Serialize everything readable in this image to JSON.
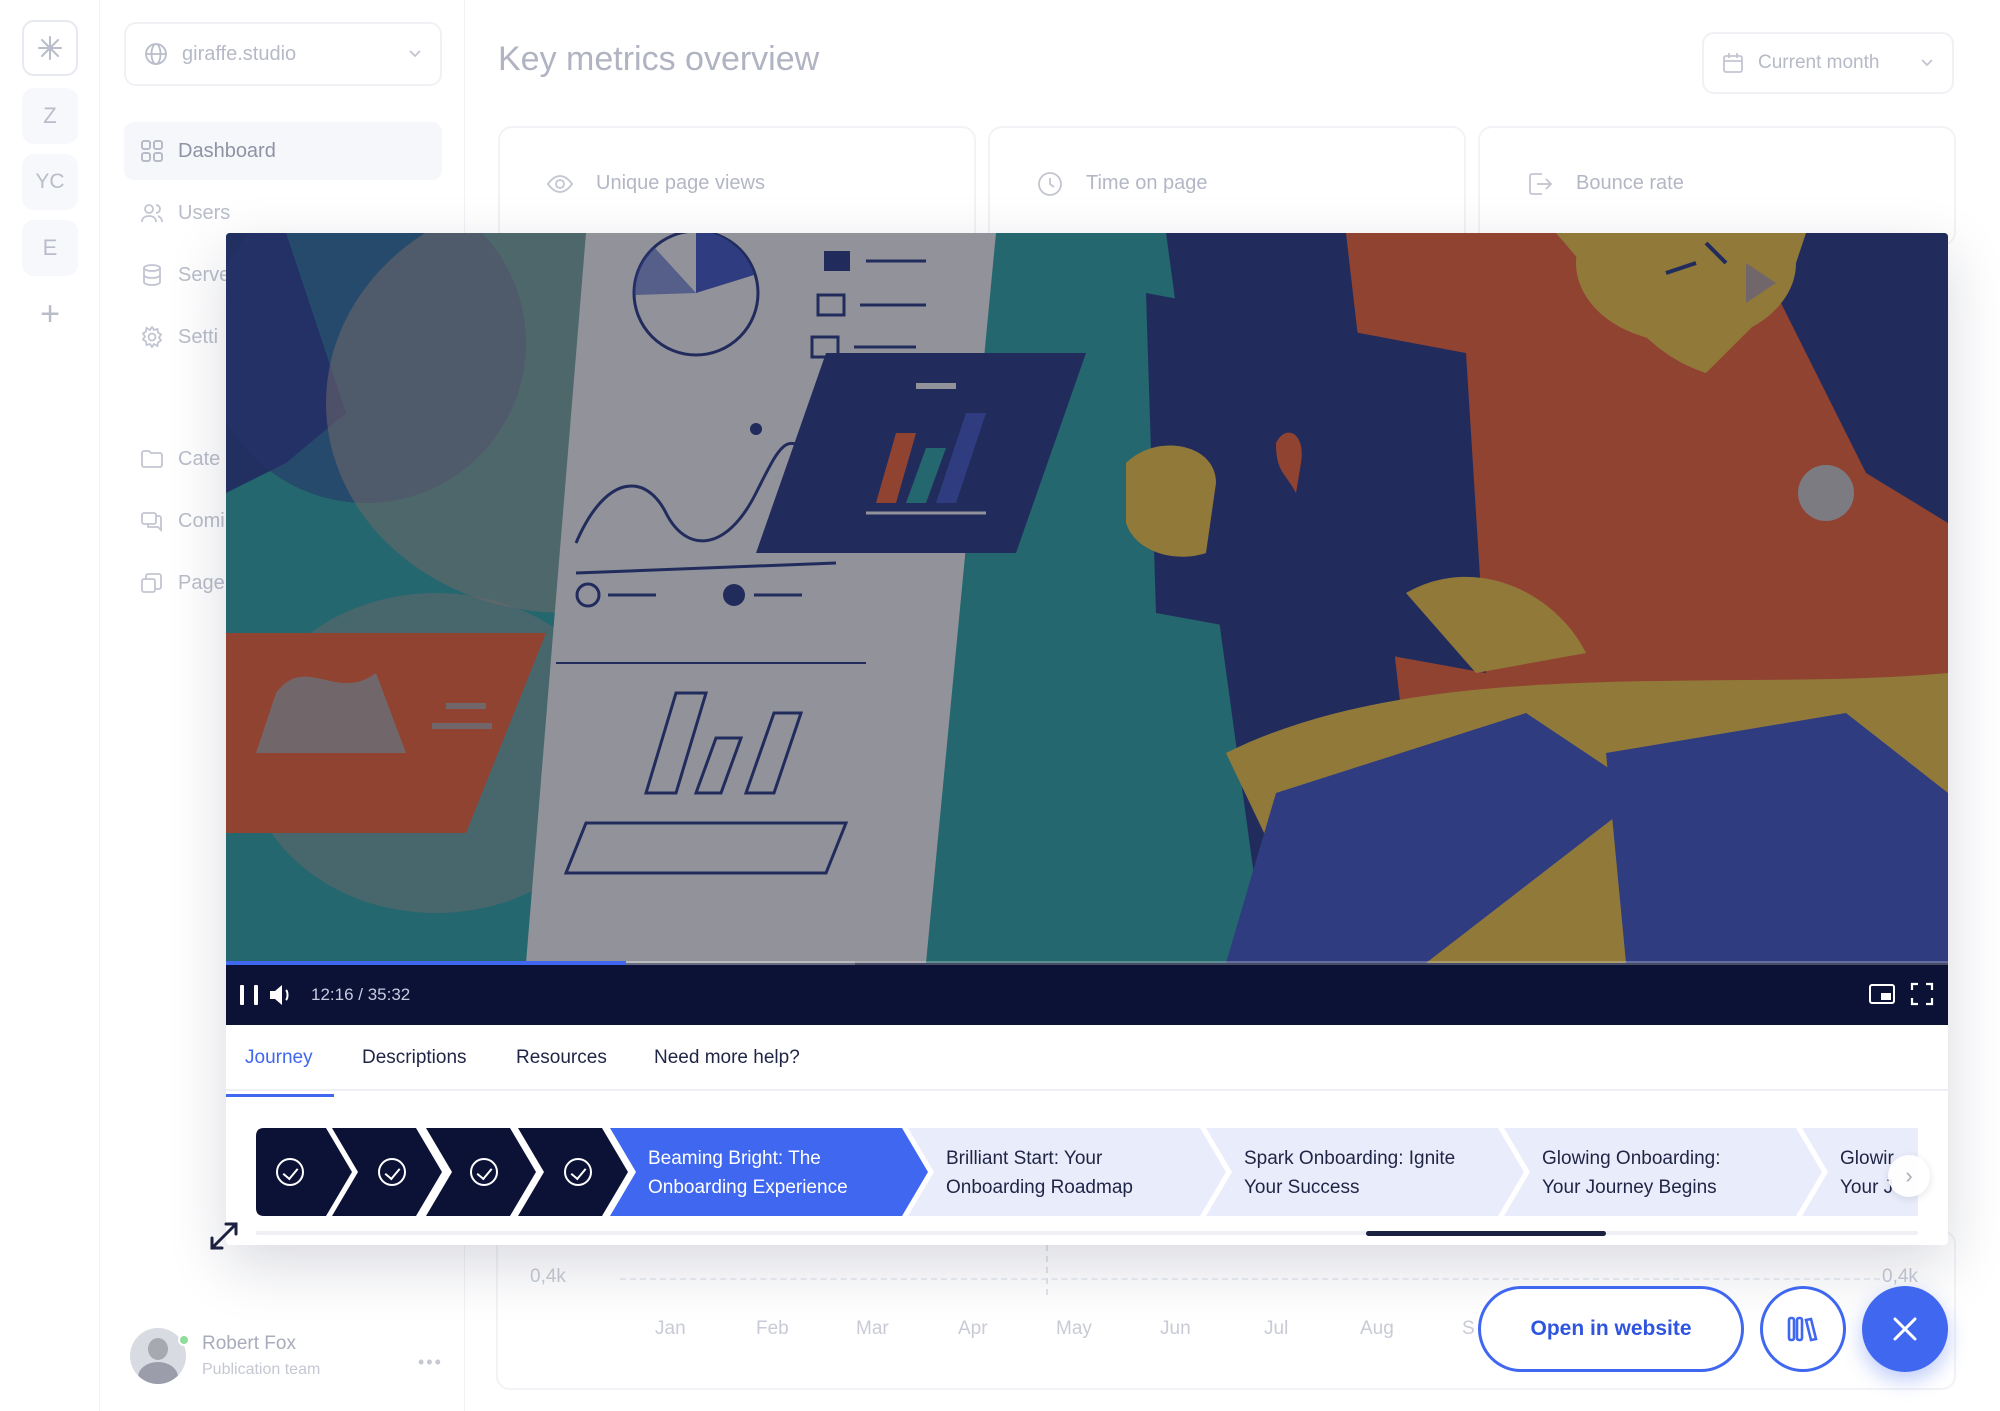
{
  "rail": {
    "items": [
      "Z",
      "YC",
      "E"
    ]
  },
  "workspace": {
    "name": "giraffe.studio"
  },
  "sidebar": {
    "items": [
      {
        "label": "Dashboard",
        "icon": "grid-icon",
        "active": true
      },
      {
        "label": "Users",
        "icon": "users-icon"
      },
      {
        "label": "Serve",
        "icon": "database-icon"
      },
      {
        "label": "Setti",
        "icon": "gear-icon"
      },
      {
        "label": "Cate",
        "icon": "folder-icon"
      },
      {
        "label": "Comi",
        "icon": "chat-icon"
      },
      {
        "label": "Page",
        "icon": "pages-icon"
      }
    ]
  },
  "user": {
    "name": "Robert Fox",
    "role": "Publication team",
    "status_color": "#8fdc9b"
  },
  "main": {
    "title": "Key metrics overview",
    "period": "Current month",
    "metrics": [
      {
        "label": "Unique page views",
        "icon": "eye-icon"
      },
      {
        "label": "Time on page",
        "icon": "clock-icon"
      },
      {
        "label": "Bounce rate",
        "icon": "exit-icon"
      }
    ],
    "chart": {
      "y_ticks": [
        "0,4k",
        "0,4k"
      ],
      "x_ticks": [
        "Jan",
        "Feb",
        "Mar",
        "Apr",
        "May",
        "Jun",
        "Jul",
        "Aug",
        "S"
      ]
    }
  },
  "player": {
    "time": "12:16 / 35:32",
    "progress": 0.232,
    "buffered": 0.365,
    "accent": "#3f67f0",
    "controls_bg": "#0b1236"
  },
  "tabs": [
    {
      "label": "Journey",
      "active": true
    },
    {
      "label": "Descriptions"
    },
    {
      "label": "Resources"
    },
    {
      "label": "Need more help?"
    }
  ],
  "journey": {
    "completed_steps": 4,
    "steps": [
      {
        "line1": "Beaming Bright: The",
        "line2": "Onboarding Experience",
        "state": "current"
      },
      {
        "line1": "Brilliant Start: Your",
        "line2": "Onboarding Roadmap",
        "state": "upcoming"
      },
      {
        "line1": "Spark Onboarding: Ignite",
        "line2": "Your Success",
        "state": "upcoming"
      },
      {
        "line1": "Glowing Onboarding:",
        "line2": "Your Journey Begins",
        "state": "upcoming"
      },
      {
        "line1": "Glowir",
        "line2": "Your J",
        "state": "upcoming"
      }
    ],
    "colors": {
      "done": "#0b1236",
      "current": "#3f67f0",
      "upcoming": "#e9edfb"
    }
  },
  "actions": {
    "open_label": "Open in website"
  }
}
